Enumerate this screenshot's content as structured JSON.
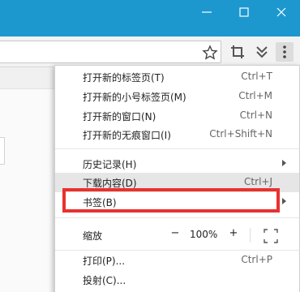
{
  "window": {
    "controls": {
      "minimize_icon": "minimize-icon",
      "maximize_icon": "maximize-icon",
      "close_icon": "close-icon"
    }
  },
  "toolbar": {
    "icons": [
      "star-icon",
      "crop-icon",
      "chevrons-down-icon",
      "more-vertical-icon"
    ]
  },
  "menu": {
    "items_group1": [
      {
        "label": "打开新的标签页(T)",
        "shortcut": "Ctrl+T"
      },
      {
        "label": "打开新的小号标签页(M)",
        "shortcut": "Ctrl+M"
      },
      {
        "label": "打开新的窗口(N)",
        "shortcut": "Ctrl+N"
      },
      {
        "label": "打开新的无痕窗口(I)",
        "shortcut": "Ctrl+Shift+N"
      }
    ],
    "history": {
      "label": "历史记录(H)"
    },
    "downloads": {
      "label": "下载内容(D)",
      "shortcut": "Ctrl+J"
    },
    "bookmarks": {
      "label": "书签(B)"
    },
    "zoom": {
      "label": "缩放",
      "minus": "−",
      "value": "100%",
      "plus": "+"
    },
    "print": {
      "label": "打印(P)...",
      "shortcut": "Ctrl+P"
    },
    "cast": {
      "label": "投射(C)..."
    }
  },
  "colors": {
    "titlebar": "#1c98cf",
    "highlight_border": "#e8312f"
  }
}
